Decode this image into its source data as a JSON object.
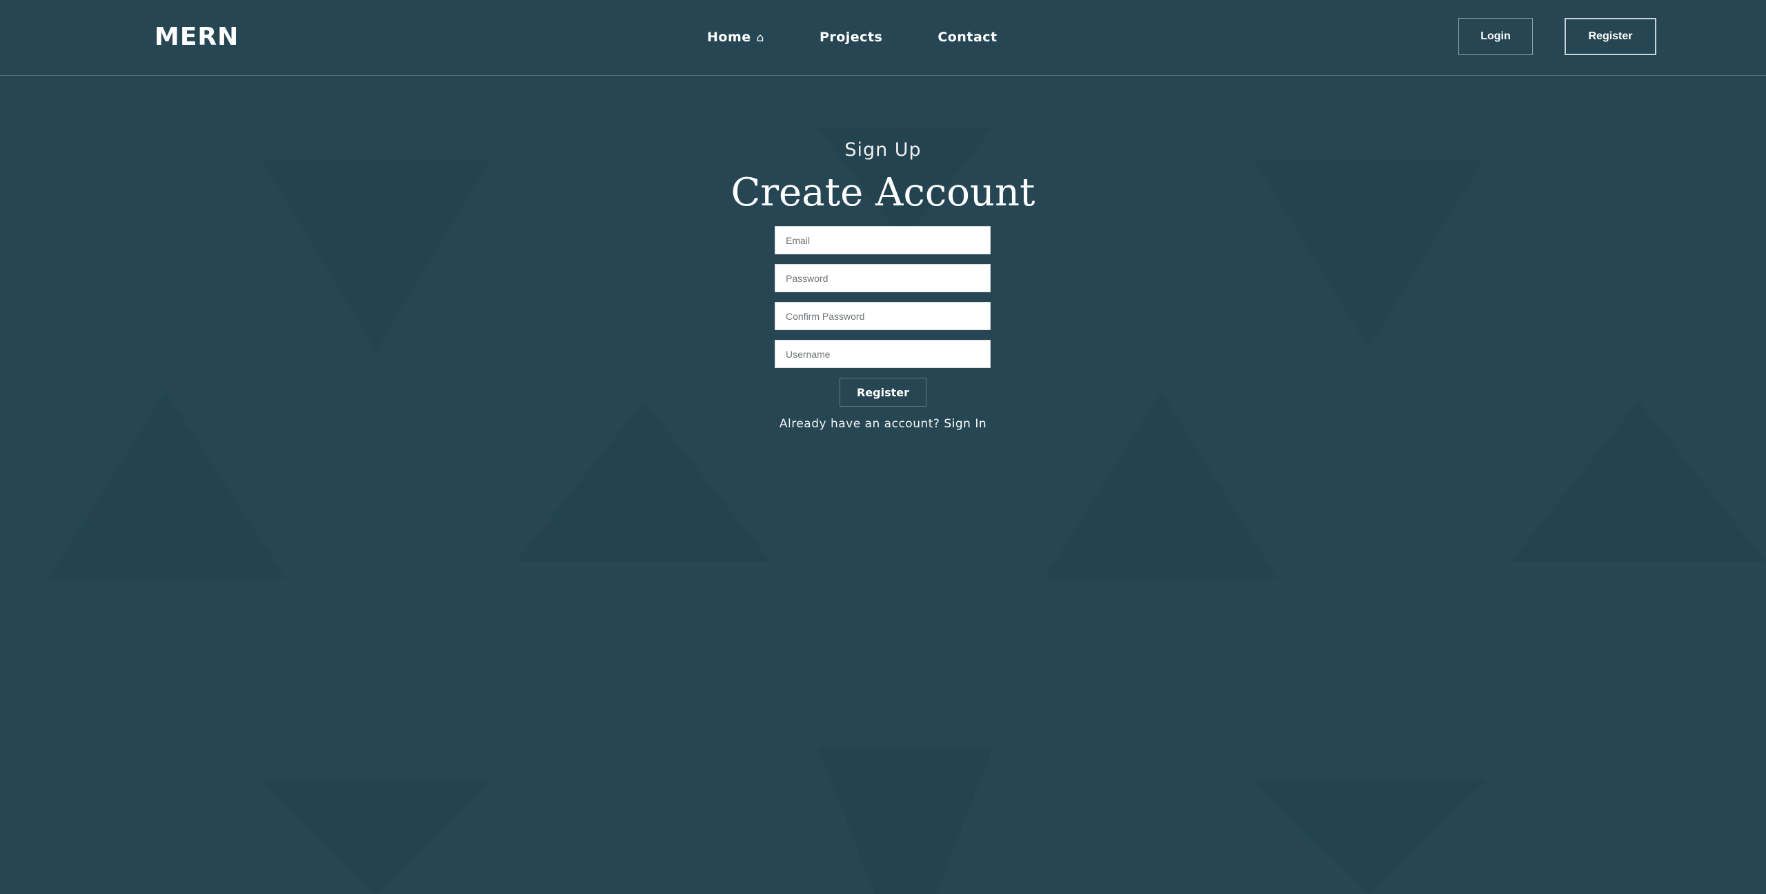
{
  "colors": {
    "background": "#264653",
    "pattern": "#22434f",
    "text": "#ffffff"
  },
  "nav": {
    "brand": "MERN",
    "links": [
      {
        "label": "Home",
        "icon": "home-icon"
      },
      {
        "label": "Projects"
      },
      {
        "label": "Contact"
      }
    ],
    "home_icon_glyph": "⌂",
    "login_label": "Login",
    "register_label": "Register"
  },
  "form": {
    "subtitle": "Sign Up",
    "title": "Create Account",
    "email_placeholder": "Email",
    "password_placeholder": "Password",
    "confirm_placeholder": "Confirm Password",
    "username_placeholder": "Username",
    "submit_label": "Register",
    "signin_prompt": "Already have an account?",
    "signin_link": "Sign In"
  }
}
